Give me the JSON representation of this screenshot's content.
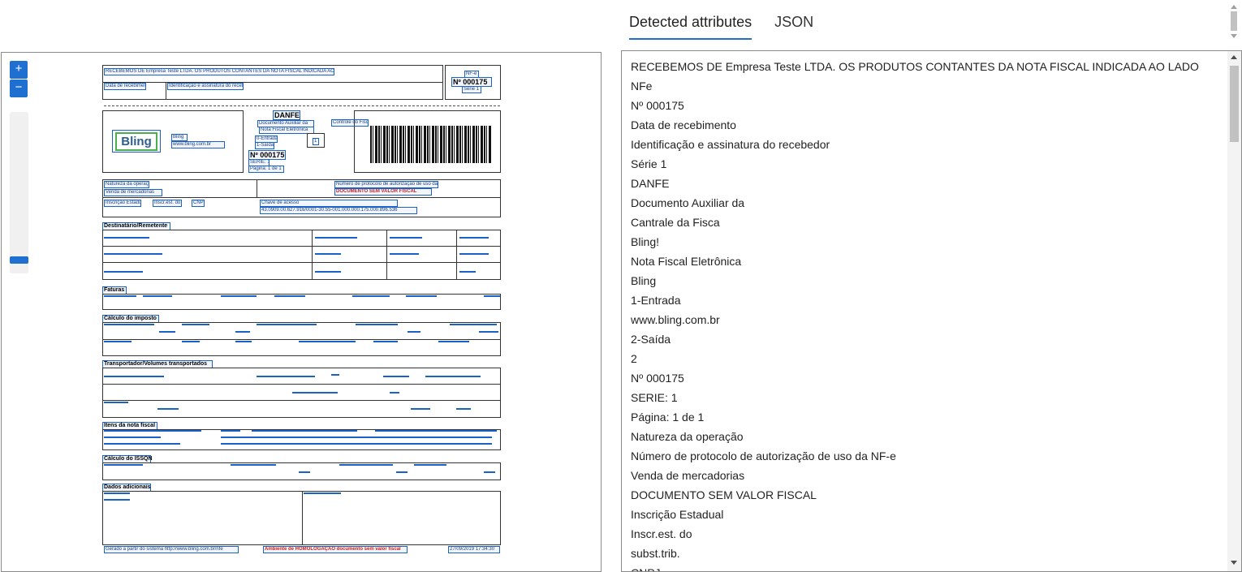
{
  "tabs": [
    {
      "label": "Detected attributes",
      "active": true
    },
    {
      "label": "JSON",
      "active": false
    }
  ],
  "viewer": {
    "zoom_in": "+",
    "zoom_out": "−",
    "zoom_level": 0.95
  },
  "doc": {
    "header_line": "RECEBEMOS DE Empresa Teste LTDA. OS PRODUTOS CONTANTES DA NOTA FISCAL INDICADA AO LADO",
    "receipt_date": "Data de recebimento",
    "receipt_sign": "Identificação e assinatura do recebedor",
    "nfe": "NF-e",
    "nfe_number": "Nº 000175",
    "serie": "Série 1",
    "danfe": "DANFE",
    "danfe_desc1": "Documento Auxiliar da",
    "danfe_desc2": "Nota Fiscal Eletrônica",
    "entrada": "0-Entrada",
    "saida": "1-Saída",
    "tipo": "1",
    "nfe_number2": "Nº 000175",
    "serie2": "SÉRIE: 1",
    "pagina": "Página: 1 de 1",
    "bling_name": "Bling",
    "bling_url": "www.bling.com.br",
    "chave_acesso": "Controle do Fisco",
    "natureza_label": "Natureza da operação",
    "natureza": "Venda de mercadorias",
    "protocolo_label": "Número de protocolo de autorização de uso da NF-e",
    "sem_valor": "DOCUMENTO SEM VALOR FISCAL",
    "ie": "Inscrição Estadual",
    "ie_st": "Inscr.est. do subst.trib.",
    "cnpj": "CNPJ",
    "chave_label": "Chave de acesso",
    "chave": "43.0909.00.627.916/0001-30.55-001.000.000.175.000.896.536",
    "dest_title": "Destinatário/Remetente",
    "faturas_title": "Faturas",
    "imposto_title": "Cálculo do imposto",
    "transp_title": "Transportador/Volumes transportados",
    "itens_title": "Itens da nota fiscal",
    "issqn_title": "Cálculo do ISSQN",
    "adicionais_title": "Dados adicionais",
    "footer": "Ambiente de HOMOLOGAÇÃO documento sem valor fiscal",
    "footer_left": "Gerado a partir do sistema http://www.bling.com.br/nfe",
    "footer_date": "27/09/2019 17:34:30"
  },
  "attributes": [
    "RECEBEMOS DE Empresa Teste LTDA. OS PRODUTOS CONTANTES DA NOTA FISCAL INDICADA AO LADO",
    "NFe",
    "Nº 000175",
    "Data de recebimento",
    "Identificação e assinatura do recebedor",
    "Série 1",
    "DANFE",
    "Documento Auxiliar da",
    "Cantrale da Fisca",
    "Bling!",
    "Nota Fiscal Eletrônica",
    "Bling",
    "1-Entrada",
    "www.bling.com.br",
    "2-Saída",
    "2",
    "Nº 000175",
    "SERIE: 1",
    "Página: 1 de 1",
    "Natureza da operação",
    "Número de protocolo de autorização de uso da NF-e",
    "Venda de mercadorias",
    "DOCUMENTO SEM VALOR FISCAL",
    "Inscrição Estadual",
    "Inscr.est. do",
    "subst.trib.",
    "CNPJ"
  ]
}
